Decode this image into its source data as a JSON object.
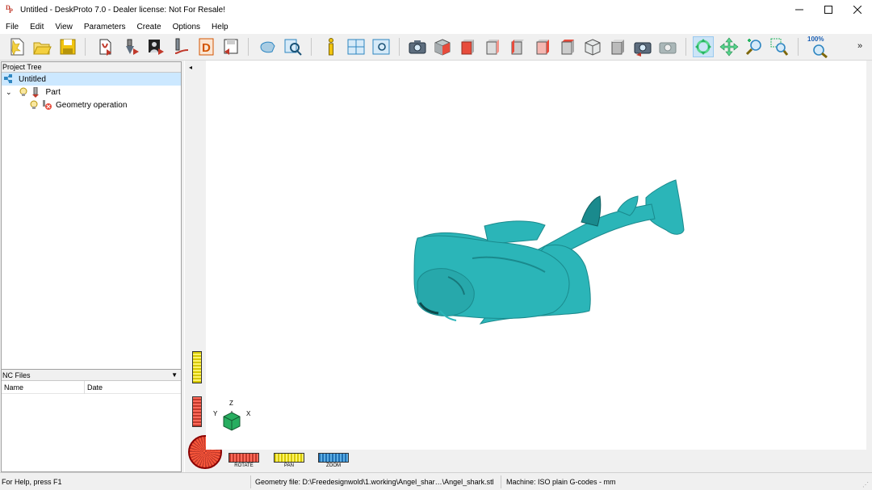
{
  "window": {
    "title": "Untitled - DeskProto 7.0 - Dealer license: Not For Resale!",
    "app_icon_text_1": "D",
    "app_icon_text_2": "P"
  },
  "menu": [
    "File",
    "Edit",
    "View",
    "Parameters",
    "Create",
    "Options",
    "Help"
  ],
  "toolbar": {
    "zoom_label": "100%",
    "active_tool": "rotate-icon"
  },
  "project_tree": {
    "header": "Project Tree",
    "root": "Untitled",
    "part": "Part",
    "operation": "Geometry operation"
  },
  "nc_files": {
    "header": "NC Files",
    "columns": [
      "Name",
      "Date"
    ]
  },
  "viewport": {
    "model_color": "#2bb5b8",
    "axis_labels": {
      "x": "X",
      "y": "Y",
      "z": "Z"
    },
    "controls": {
      "rotate": "ROTATE",
      "pan": "PAN",
      "zoom": "ZOOM"
    }
  },
  "statusbar": {
    "help": "For Help, press F1",
    "geometry": "Geometry file: D:\\Freedesignwold\\1.working\\Angel_shar…\\Angel_shark.stl",
    "machine": "Machine: ISO plain G-codes - mm"
  }
}
